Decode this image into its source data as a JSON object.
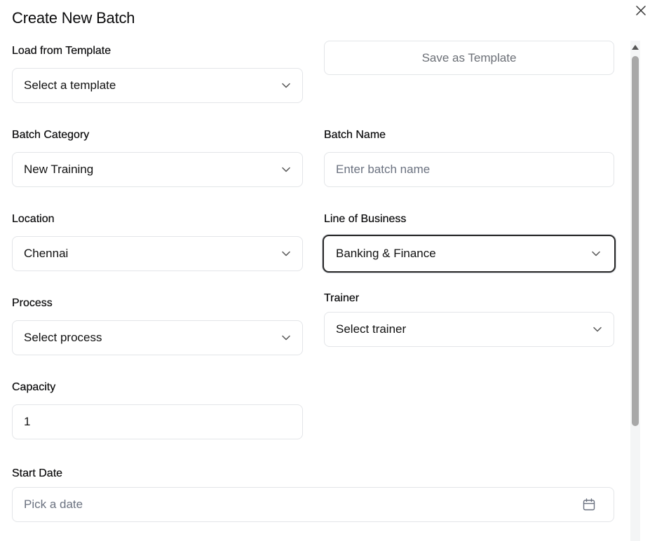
{
  "dialog": {
    "title": "Create New Batch"
  },
  "template": {
    "label": "Load from Template",
    "placeholder": "Select a template",
    "save_button": "Save as Template"
  },
  "batch_category": {
    "label": "Batch Category",
    "value": "New Training"
  },
  "batch_name": {
    "label": "Batch Name",
    "placeholder": "Enter batch name"
  },
  "location": {
    "label": "Location",
    "value": "Chennai"
  },
  "line_of_business": {
    "label": "Line of Business",
    "value": "Banking & Finance"
  },
  "process": {
    "label": "Process",
    "placeholder": "Select process"
  },
  "trainer": {
    "label": "Trainer",
    "placeholder": "Select trainer"
  },
  "capacity": {
    "label": "Capacity",
    "value": "1"
  },
  "start_date": {
    "label": "Start Date",
    "placeholder": "Pick a date"
  },
  "icons": {
    "close": "close-icon",
    "chevron": "chevron-down-icon",
    "calendar": "calendar-icon",
    "scroll_up": "scroll-up-arrow-icon"
  },
  "colors": {
    "border": "#e3e5e8",
    "focus_border": "#2a2a2a",
    "placeholder": "#6b7280",
    "scrollbar_thumb": "#a8a8a8"
  }
}
